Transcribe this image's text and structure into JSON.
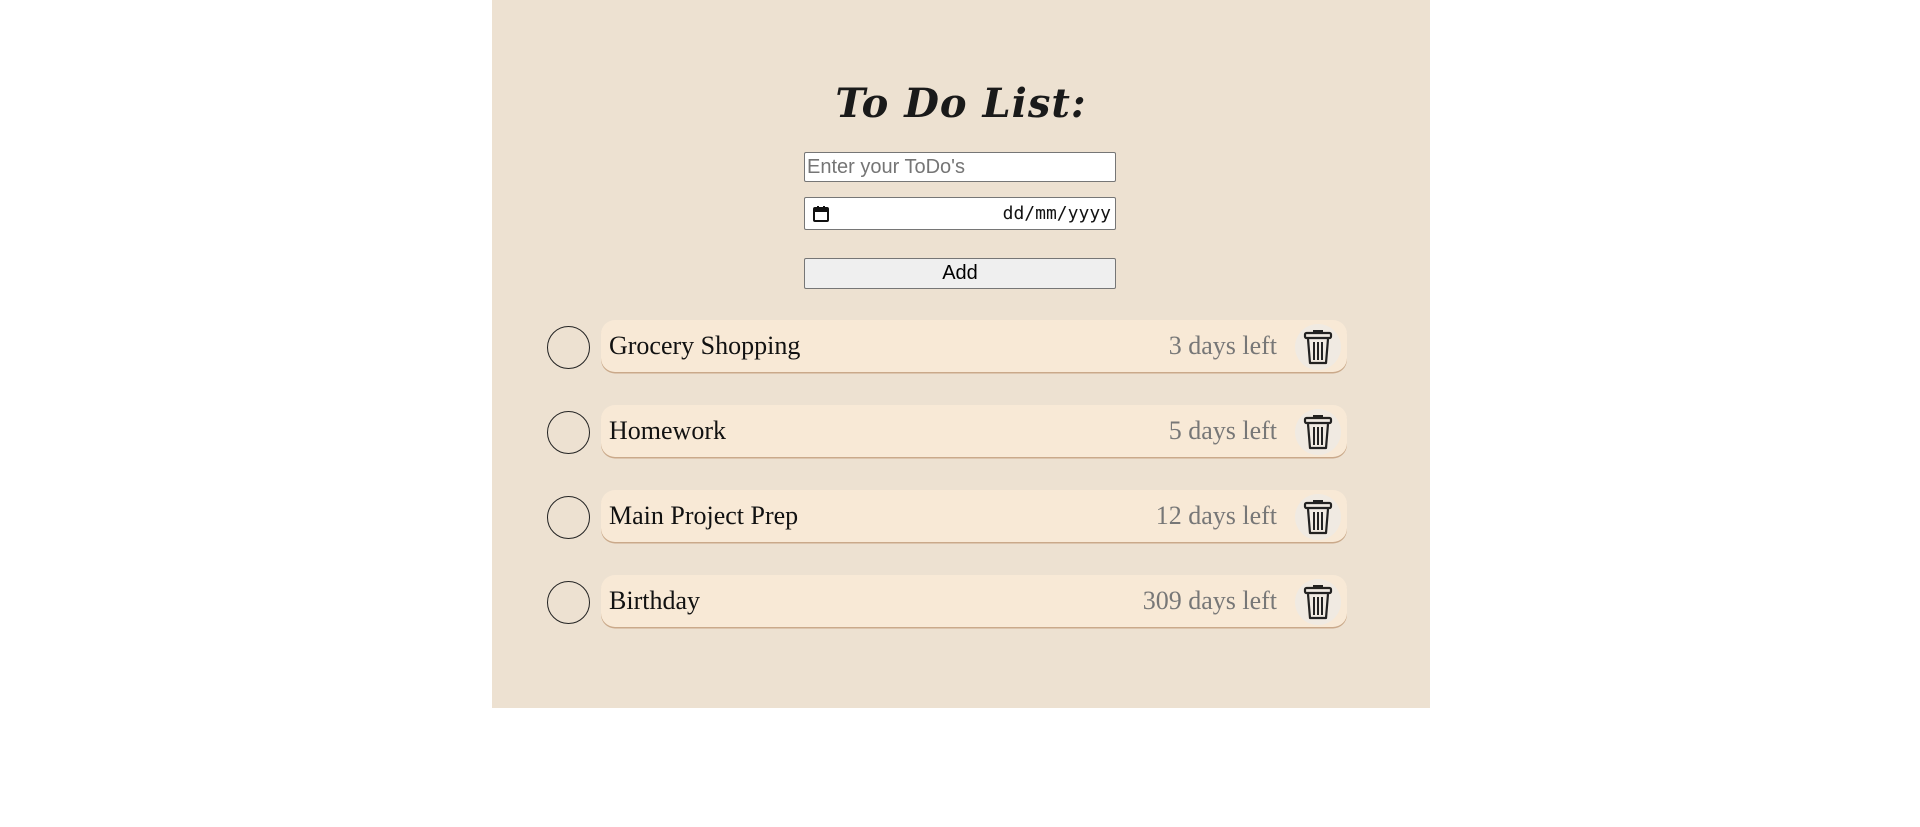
{
  "header": {
    "title": "To Do List:"
  },
  "form": {
    "todo_placeholder": "Enter your ToDo's",
    "todo_value": "",
    "date_placeholder": "dd/mm/yyyy",
    "add_label": "Add"
  },
  "todos": [
    {
      "title": "Grocery Shopping",
      "days_left": "3 days left",
      "completed": false,
      "delete_icon": "trash-icon"
    },
    {
      "title": "Homework",
      "days_left": "5 days left",
      "completed": false,
      "delete_icon": "trash-icon"
    },
    {
      "title": "Main Project Prep",
      "days_left": "12 days left",
      "completed": false,
      "delete_icon": "trash-icon"
    },
    {
      "title": "Birthday",
      "days_left": "309 days left",
      "completed": false,
      "delete_icon": "trash-icon"
    }
  ],
  "icons": {
    "date": "calendar-icon",
    "delete": "trash-icon"
  },
  "colors": {
    "app_background": "#ede1d1",
    "item_background": "#f8e9d6",
    "days_text": "#777777",
    "page_background": "#ffffff"
  }
}
